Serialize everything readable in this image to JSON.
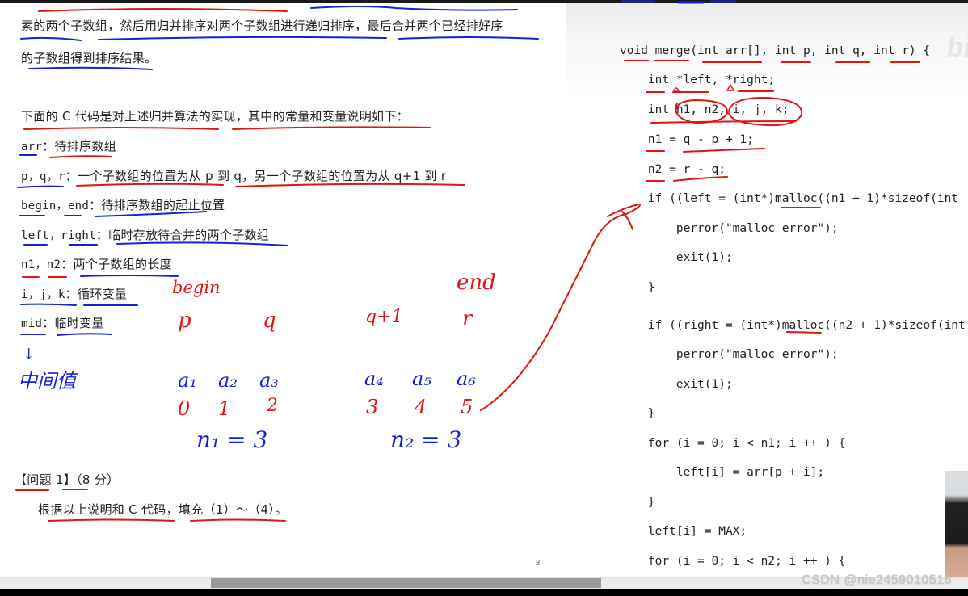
{
  "document": {
    "intro_line_1": "素的两个子数组，然后用归并排序对两个子数组进行递归排序，最后合并两个已经排好序",
    "intro_line_2": "的子数组得到排序结果。",
    "code_intro": "下面的 C 代码是对上述归并算法的实现，其中的常量和变量说明如下：",
    "variables": [
      {
        "name": "arr",
        "sep": "：",
        "desc": "待排序数组"
      },
      {
        "name": "p，q，r",
        "sep": "：",
        "desc": "一个子数组的位置为从 p 到 q，另一个子数组的位置为从 q+1 到 r"
      },
      {
        "name": "begin，end",
        "sep": "：",
        "desc": "待排序数组的起止位置"
      },
      {
        "name": "left，right",
        "sep": "：",
        "desc": "临时存放待合并的两个子数组"
      },
      {
        "name": "n1，n2",
        "sep": "：",
        "desc": "两个子数组的长度"
      },
      {
        "name": "i，j，k",
        "sep": "：",
        "desc": "循环变量"
      },
      {
        "name": "mid",
        "sep": "：",
        "desc": "临时变量"
      }
    ],
    "question_title": "【问题 1】",
    "question_score": "（8 分）",
    "question_text": "根据以上说明和 C 代码，填充（1）～（4）。"
  },
  "code": {
    "lines": [
      "void merge(int arr[], int p, int q, int r) {",
      "    int *left, *right;",
      "    int n1, n2, i, j, k;",
      "    n1 = q - p + 1;",
      "    n2 = r - q;",
      "    if ((left = (int*)malloc((n1 + 1)*sizeof(int",
      "        perror(\"malloc error\");",
      "        exit(1);",
      "    }",
      "    if ((right = (int*)malloc((n2 + 1)*sizeof(int",
      "        perror(\"malloc error\");",
      "        exit(1);",
      "    }",
      "    for (i = 0; i < n1; i ++ ) {",
      "        left[i] = arr[p + i];",
      "    }",
      "    left[i] = MAX;",
      "    for (i = 0; i < n2; i ++ ) {"
    ]
  },
  "annotations": {
    "mid_note": "中间值",
    "begin_label": "begin",
    "end_label": "end",
    "p_label": "p",
    "q_label": "q",
    "q1_label": "q+1",
    "r_label": "r",
    "elements_left": [
      "a₁",
      "a₂",
      "a₃"
    ],
    "elements_right": [
      "a₄",
      "a₅",
      "a₆"
    ],
    "indices_left": [
      "0",
      "1",
      "2"
    ],
    "indices_right": [
      "3",
      "4",
      "5"
    ],
    "n1_note": "n₁ = 3",
    "n2_note": "n₂ = 3"
  },
  "overlay": {
    "watermark": "CSDN @nie2459010516",
    "site_logo": "bili",
    "scroll_position": 0.22
  },
  "colors": {
    "ink_red": "#e01515",
    "ink_blue": "#1522d8"
  }
}
